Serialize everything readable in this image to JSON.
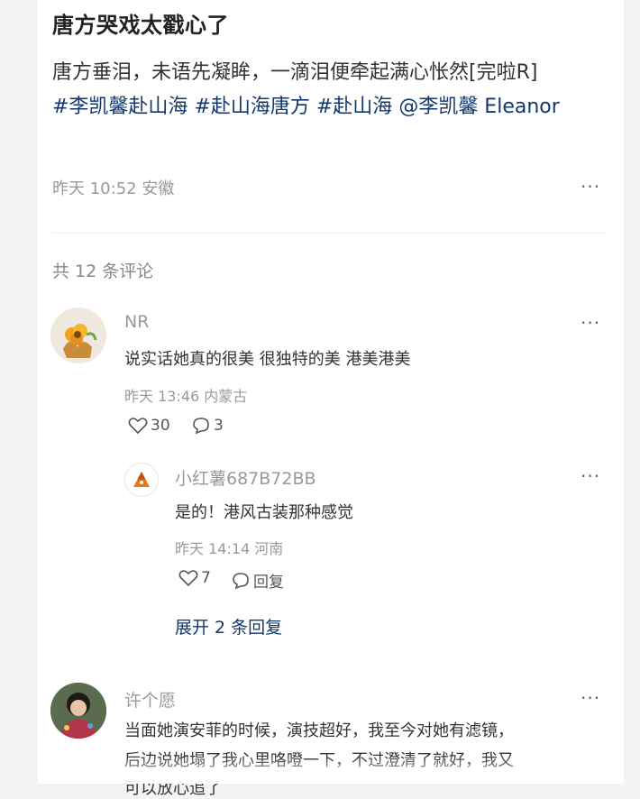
{
  "post": {
    "title": "唐方哭戏太戳心了",
    "body_text": "唐方垂泪，未语先凝眸，一滴泪便牵起满心怅然[完啦R]",
    "tags": [
      "#李凯馨赴山海",
      "#赴山海唐方",
      "#赴山海",
      "@李凯馨 Eleanor"
    ],
    "time_location": "昨天 10:52 安徽",
    "more_glyph": "···"
  },
  "comments_header": {
    "count_label": "共 12 条评论"
  },
  "comments": [
    {
      "username": "NR",
      "text": "说实话她真的很美 很独特的美 港美港美",
      "time_location": "昨天 13:46 内蒙古",
      "likes": "30",
      "replies": "3",
      "more_glyph": "···",
      "reply": {
        "username": "小红薯687B72BB",
        "text": "是的！港风古装那种感觉",
        "time_location": "昨天 14:14 河南",
        "likes": "7",
        "reply_label": "回复",
        "more_glyph": "···"
      },
      "expand_label": "展开 2 条回复"
    },
    {
      "username": "许个愿",
      "text_lines": [
        "当面她演安菲的时候，演技超好，我至今对她有滤镜，",
        "后边说她塌了我心里咯噔一下，不过澄清了就好，我又",
        "可以放心追了"
      ],
      "more_glyph": "···"
    }
  ],
  "colors": {
    "tag": "#13386c",
    "muted": "#999999",
    "background": "#f3f3f4"
  },
  "icons": [
    "heart-outline-icon",
    "comment-bubble-icon",
    "more-dots-icon"
  ]
}
